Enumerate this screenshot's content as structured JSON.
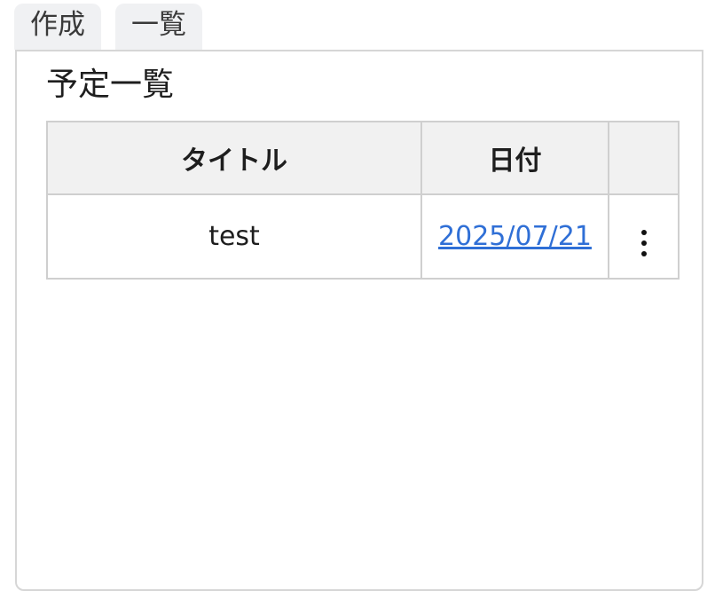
{
  "tabs": [
    {
      "label": "作成"
    },
    {
      "label": "一覧"
    }
  ],
  "panel": {
    "title": "予定一覧"
  },
  "table": {
    "headers": [
      "タイトル",
      "日付",
      ""
    ],
    "rows": [
      {
        "title": "test",
        "date": "2025/07/21"
      }
    ]
  },
  "colors": {
    "link": "#2f6fd6",
    "tab_bg": "#f0f1f3",
    "header_bg": "#f1f1f1",
    "border": "#cfcfcf"
  }
}
